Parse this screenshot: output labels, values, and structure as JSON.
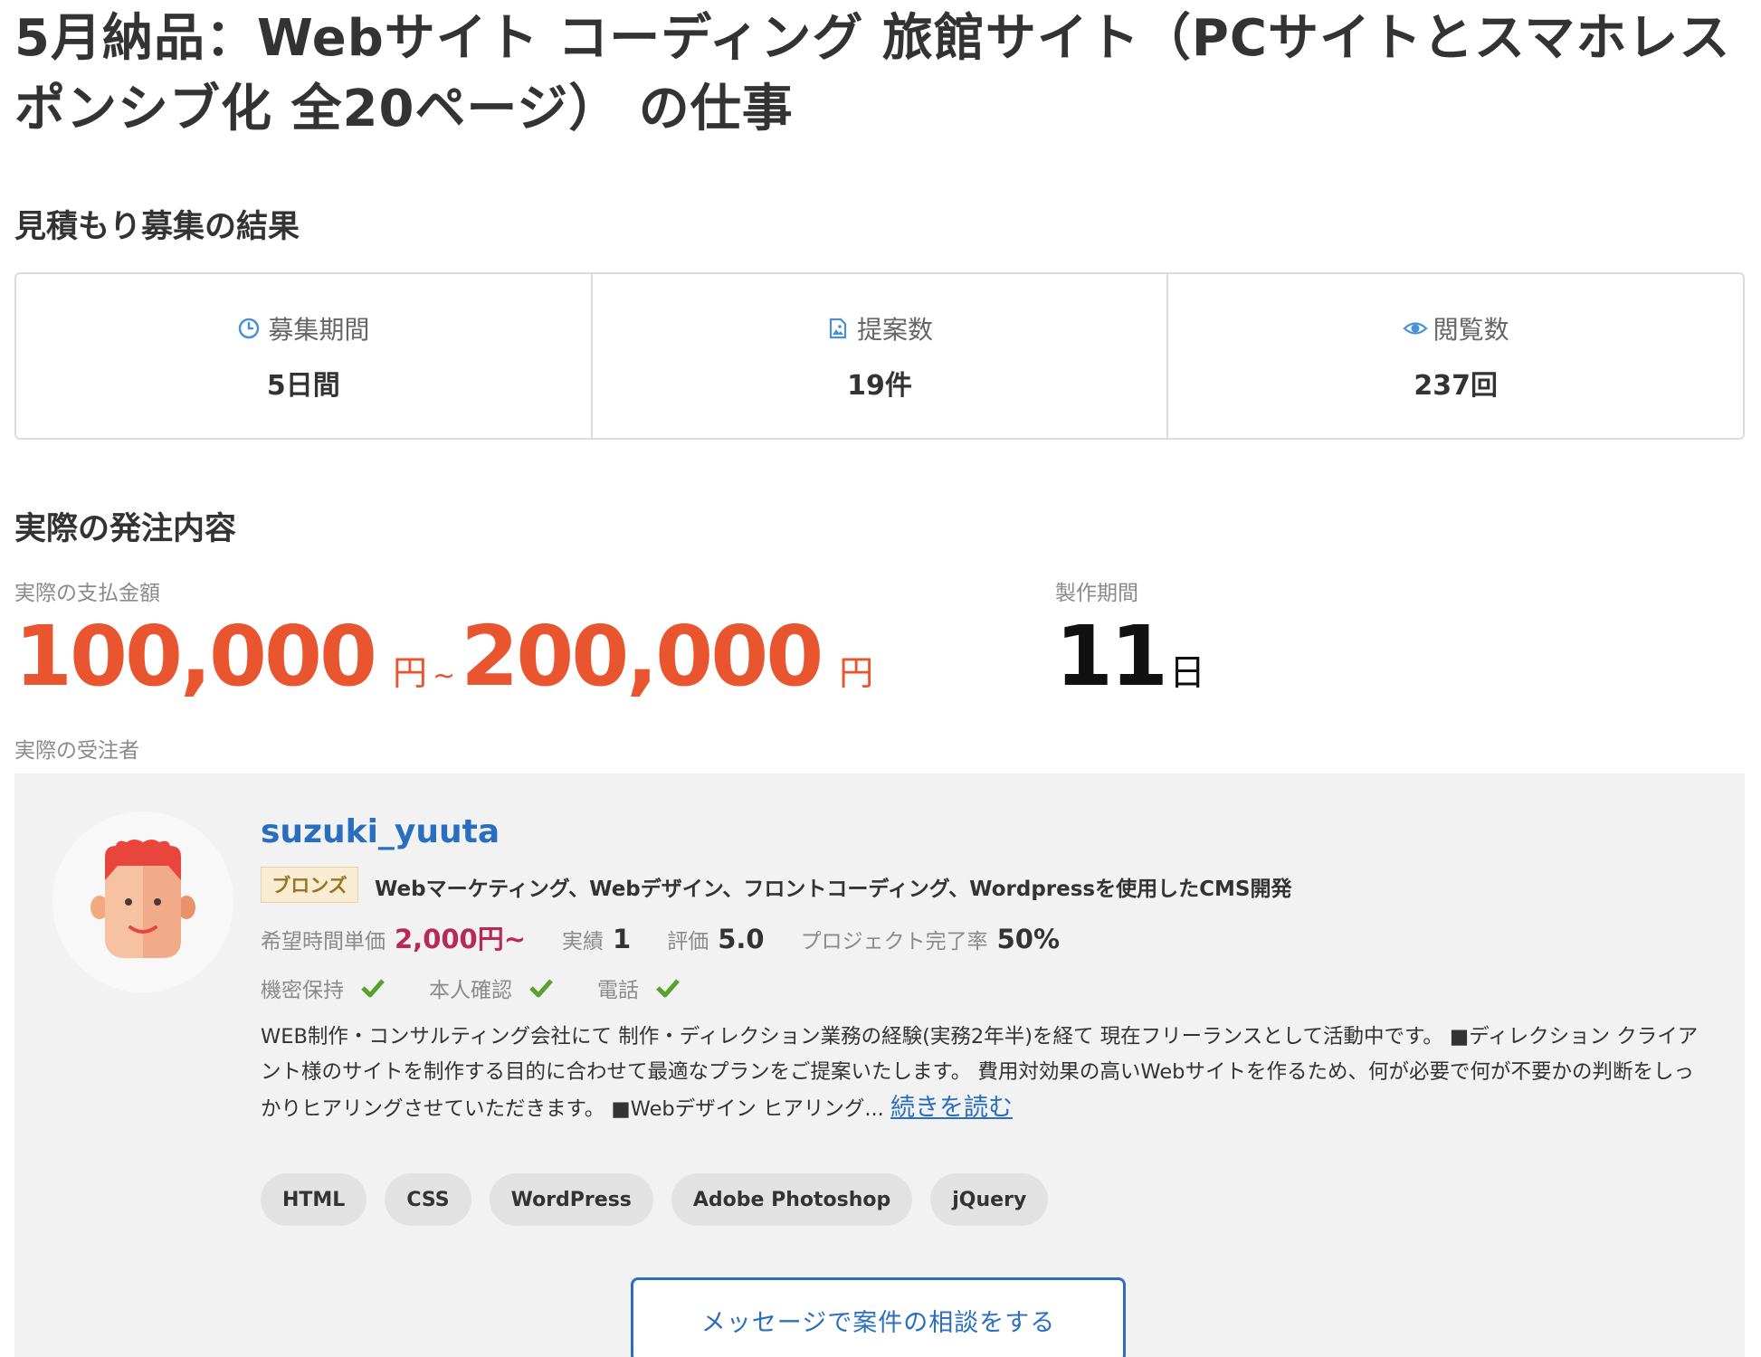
{
  "job": {
    "title": "5月納品：Webサイト コーディング 旅館サイト（PCサイトとスマホレスポンシブ化 全20ページ） の仕事"
  },
  "results": {
    "heading": "見積もり募集の結果",
    "stats": [
      {
        "icon": "clock-icon",
        "label": "募集期間",
        "value": "5日間"
      },
      {
        "icon": "proposal-doc-icon",
        "label": "提案数",
        "value": "19件"
      },
      {
        "icon": "eye-icon",
        "label": "閲覧数",
        "value": "237回"
      }
    ]
  },
  "order": {
    "heading": "実際の発注内容",
    "payment_label": "実際の支払金額",
    "payment_min": "100,000",
    "payment_max": "200,000",
    "currency": "円",
    "range_sep": "~",
    "period_label": "製作期間",
    "period_value": "11",
    "period_unit": "日",
    "contractor_label": "実際の受注者"
  },
  "contractor": {
    "username": "suzuki_yuuta",
    "rank": "ブロンズ",
    "skills_summary": "Webマーケティング、Webデザイン、フロントコーディング、Wordpressを使用したCMS開発",
    "rate_label": "希望時間単価",
    "rate_value": "2,000円~",
    "record_label": "実績",
    "record_value": "1",
    "rating_label": "評価",
    "rating_value": "5.0",
    "completion_label": "プロジェクト完了率",
    "completion_value": "50%",
    "verifications": [
      {
        "label": "機密保持",
        "verified": true
      },
      {
        "label": "本人確認",
        "verified": true
      },
      {
        "label": "電話",
        "verified": true
      }
    ],
    "bio": "WEB制作・コンサルティング会社にて 制作・ディレクション業務の経験(実務2年半)を経て 現在フリーランスとして活動中です。 ■ディレクション クライアント様のサイトを制作する目的に合わせて最適なプランをご提案いたします。 費用対効果の高いWebサイトを作るため、何が必要で何が不要かの判断をしっかりヒアリングさせていただきます。 ■Webデザイン ヒアリング...",
    "read_more": "続きを読む",
    "tags": [
      "HTML",
      "CSS",
      "WordPress",
      "Adobe Photoshop",
      "jQuery"
    ],
    "consult_button": "メッセージで案件の相談をする"
  },
  "colors": {
    "accent_blue": "#2a6fbf",
    "price_orange": "#e8552f",
    "rate_magenta": "#b8295a",
    "check_green": "#5aa02c",
    "card_bg": "#f2f2f2"
  }
}
